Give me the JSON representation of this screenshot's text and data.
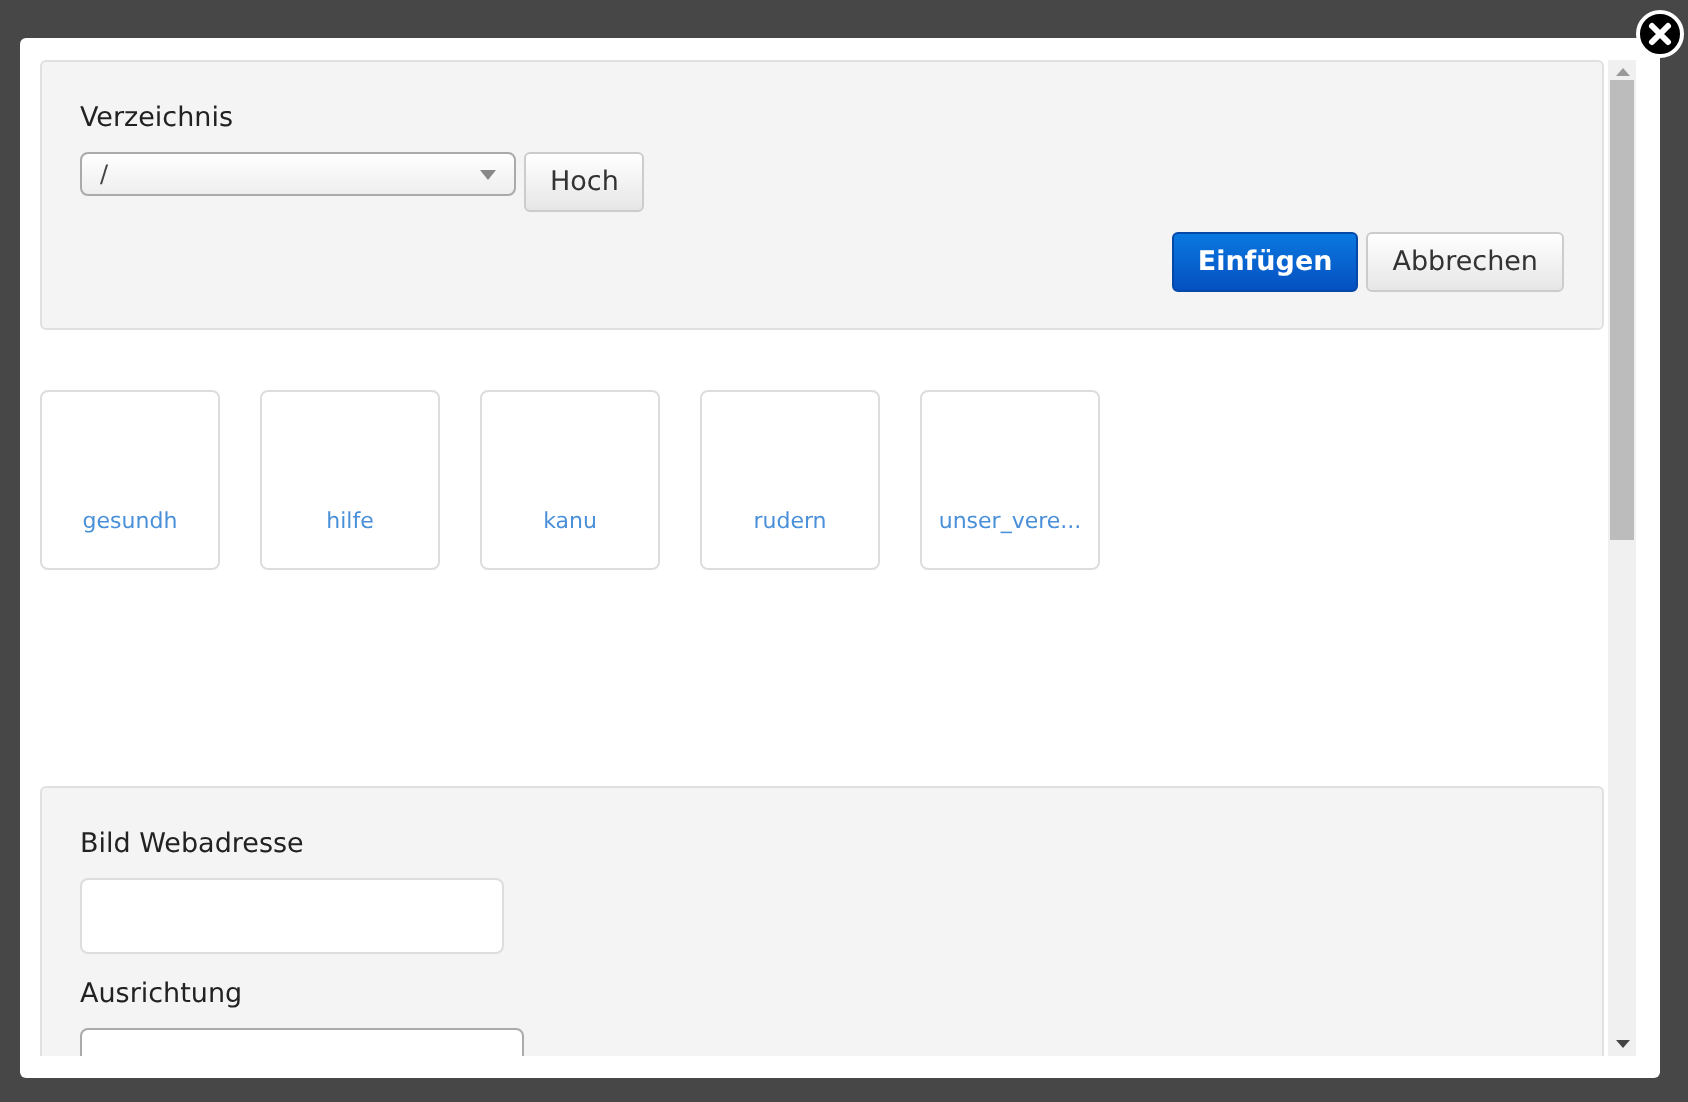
{
  "directory": {
    "label": "Verzeichnis",
    "value": "/",
    "up_button": "Hoch"
  },
  "buttons": [
    {
      "label": "Einfügen",
      "kind": "primary"
    },
    {
      "label": "Abbrechen",
      "kind": "default"
    }
  ],
  "folders": [
    {
      "name": "gesundh"
    },
    {
      "name": "hilfe"
    },
    {
      "name": "kanu"
    },
    {
      "name": "rudern"
    },
    {
      "name": "unser_vere..."
    }
  ],
  "image_form": {
    "url_label": "Bild Webadresse",
    "align_label": "Ausrichtung"
  }
}
